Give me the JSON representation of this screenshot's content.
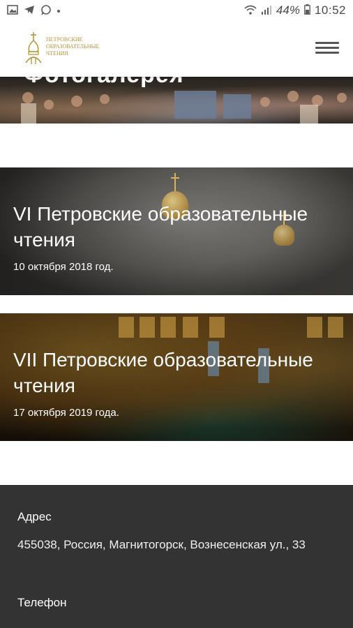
{
  "status_bar": {
    "battery_percent": "44%",
    "time": "10:52",
    "icons": [
      "image-icon",
      "telegram-icon",
      "whatsapp-icon",
      "dot-icon",
      "wifi-icon",
      "signal-icon",
      "battery-icon"
    ]
  },
  "header": {
    "logo_text": "Петровские образовательные чтения",
    "menu_icon": "hamburger-menu-icon"
  },
  "gallery_banner": {
    "title": "Фотогалерея"
  },
  "events": [
    {
      "title": "VI Петровские образовательные чтения",
      "date": "10 октября 2018 год."
    },
    {
      "title": "VII Петровские образовательные чтения",
      "date": "17 октября 2019 года."
    }
  ],
  "footer": {
    "address_label": "Адрес",
    "address_value": "455038, Россия, Магнитогорск, Вознесенская ул., 33",
    "phone_label": "Телефон"
  },
  "colors": {
    "logo_gold": "#b8912f",
    "footer_bg": "#333333"
  }
}
